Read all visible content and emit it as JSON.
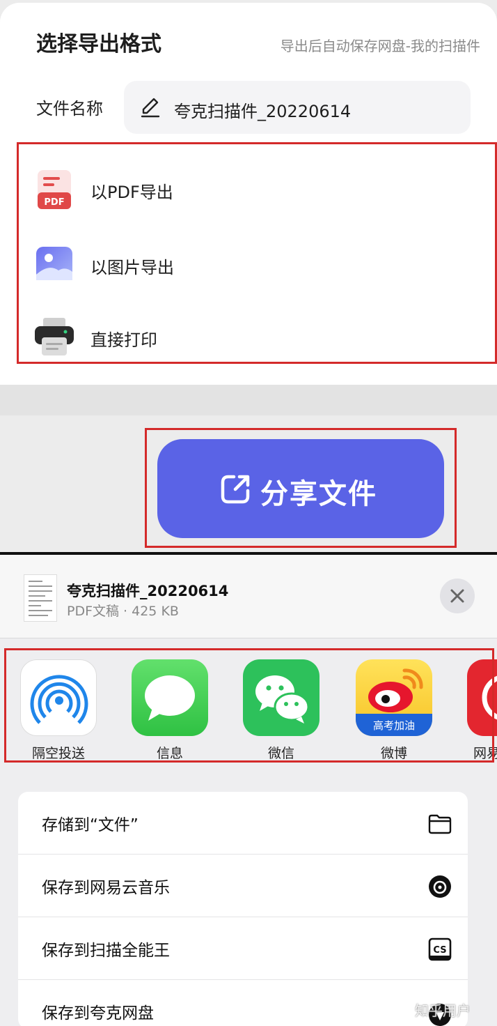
{
  "export_panel": {
    "title": "选择导出格式",
    "hint": "导出后自动保存网盘-我的扫描件",
    "filename_label": "文件名称",
    "filename_value": "夸克扫描件_20220614",
    "options": [
      {
        "label": "以PDF导出",
        "icon": "pdf-file-icon",
        "badge": "PDF"
      },
      {
        "label": "以图片导出",
        "icon": "image-icon"
      },
      {
        "label": "直接打印",
        "icon": "printer-icon"
      }
    ],
    "share_button_label": "分享文件",
    "accent_color": "#5a63e6",
    "highlight_color": "#d42a2a"
  },
  "share_sheet": {
    "doc_title": "夸克扫描件_20220614",
    "doc_meta": "PDF文稿 · 425 KB",
    "apps": [
      {
        "label": "隔空投送",
        "icon": "airdrop-icon"
      },
      {
        "label": "信息",
        "icon": "messages-icon"
      },
      {
        "label": "微信",
        "icon": "wechat-icon"
      },
      {
        "label": "微博",
        "icon": "weibo-icon",
        "badge": "高考加油"
      },
      {
        "label": "网易",
        "icon": "netease-music-icon"
      }
    ],
    "actions": [
      {
        "label": "存储到“文件”",
        "icon": "folder-icon"
      },
      {
        "label": "保存到网易云音乐",
        "icon": "netease-music-icon"
      },
      {
        "label": "保存到扫描全能王",
        "icon": "camscanner-icon",
        "badge": "CS"
      },
      {
        "label": "保存到夸克网盘",
        "icon": "quark-icon"
      }
    ]
  },
  "watermark": "知乎用户"
}
